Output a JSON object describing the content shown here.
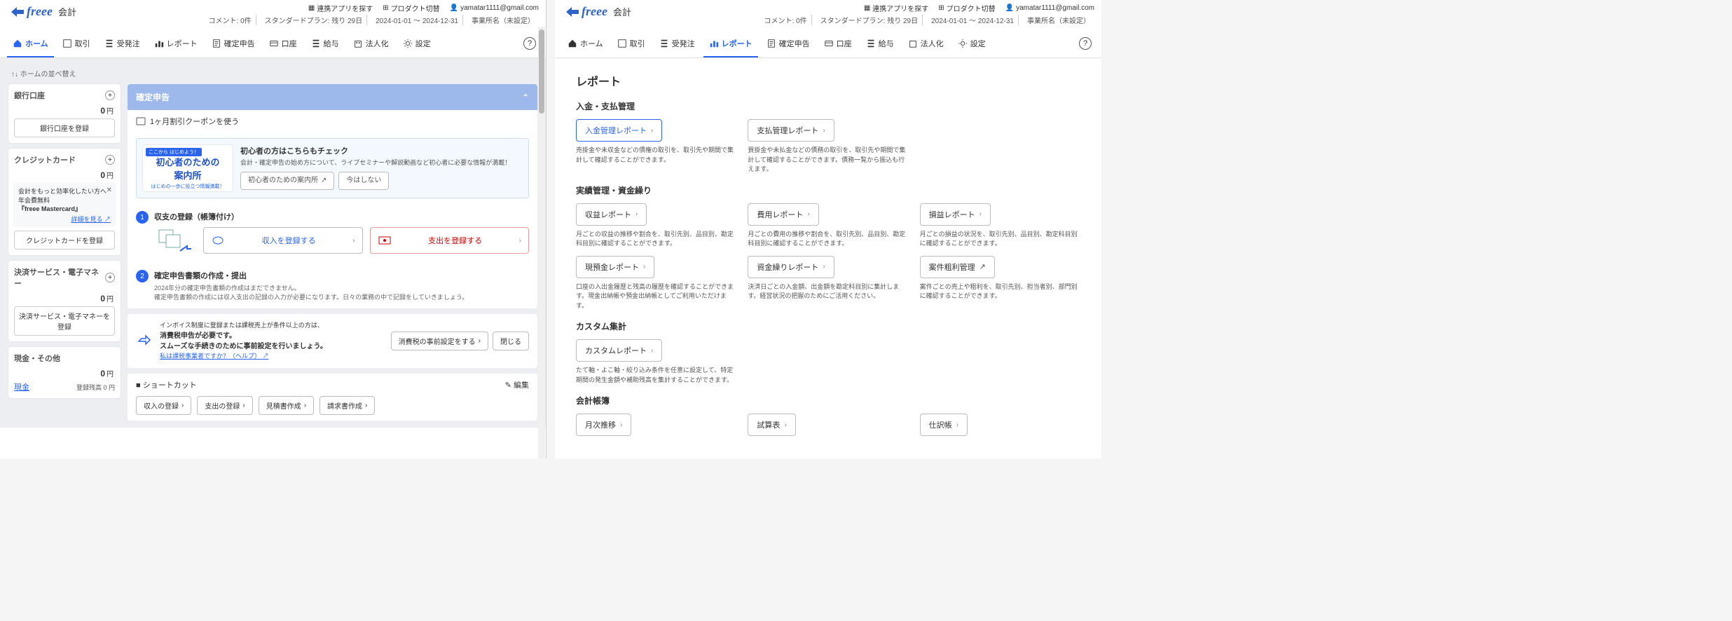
{
  "brand": {
    "name": "freee",
    "suffix": "会計"
  },
  "topbar": {
    "apps": "連携アプリを探す",
    "switch": "プロダクト切替",
    "user": "yamatar1111@gmail.com"
  },
  "statusbar": {
    "comment": "コメント: 0件",
    "plan": "スタンダードプラン: 残り 29日",
    "period": "2024-01-01 ～ 2024-12-31",
    "office": "事業所名（未設定）"
  },
  "nav": {
    "items": [
      {
        "label": "ホーム",
        "icon": "home"
      },
      {
        "label": "取引",
        "icon": "doc"
      },
      {
        "label": "受発注",
        "icon": "list"
      },
      {
        "label": "レポート",
        "icon": "chart"
      },
      {
        "label": "確定申告",
        "icon": "form"
      },
      {
        "label": "口座",
        "icon": "card"
      },
      {
        "label": "給与",
        "icon": "pay"
      },
      {
        "label": "法人化",
        "icon": "bldg"
      },
      {
        "label": "設定",
        "icon": "gear"
      }
    ]
  },
  "left_pane": {
    "crumb": "↑↓ ホームの並べ替え",
    "sidebar": {
      "bank": {
        "title": "銀行口座",
        "amount": "0",
        "unit": "円",
        "btn": "銀行口座を登録"
      },
      "cc": {
        "title": "クレジットカード",
        "amount": "0",
        "unit": "円",
        "promo": {
          "l1": "会計をもっと効率化したい方へ",
          "l2": "年会費無料",
          "l3": "『freee Mastercard』",
          "link": "詳細を見る"
        },
        "btn": "クレジットカードを登録"
      },
      "ps": {
        "title": "決済サービス・電子マネー",
        "amount": "0",
        "unit": "円",
        "btn": "決済サービス・電子マネーを登録"
      },
      "cash": {
        "title": "現金・その他",
        "amount": "0",
        "unit": "円",
        "link": "現金",
        "sub": "登録残高 0 円"
      }
    },
    "main": {
      "kakutei_title": "確定申告",
      "coupon": "1ヶ月割引クーポンを使う",
      "guide": {
        "img_ribbon": "ここから\nはじめよう！",
        "img_big": "初心者のための",
        "img_big2": "案内所",
        "img_foot": "はじめの一歩に役立つ情報満載！",
        "title": "初心者の方はこちらもチェック",
        "desc": "会計・確定申告の始め方について、ライブセミナーや解説動画など初心者に必要な情報が満載！",
        "btn1": "初心者のための案内所",
        "btn2": "今はしない"
      },
      "step1": {
        "num": "1",
        "title": "収支の登録（帳簿付け）",
        "btn_in": "収入を登録する",
        "btn_out": "支出を登録する"
      },
      "step2": {
        "num": "2",
        "title": "確定申告書類の作成・提出",
        "l1": "2024年分の確定申告書類の作成はまだできません。",
        "l2": "確定申告書類の作成には収入支出の記録の入力が必要になります。日々の業務の中で記録をしていきましょう。"
      },
      "invoice": {
        "l1": "インボイス制度に登録または課税売上が条件以上の方は、",
        "l2": "消費税申告が必要です。",
        "l3": "スムーズな手続きのために事前設定を行いましょう。",
        "link": "私は課税事業者ですか？（ヘルプ）",
        "btn1": "消費税の事前設定をする",
        "btn2": "閉じる"
      },
      "shortcut": {
        "title": "ショートカット",
        "edit": "編集",
        "b1": "収入の登録",
        "b2": "支出の登録",
        "b3": "見積書作成",
        "b4": "請求書作成"
      }
    }
  },
  "right_pane": {
    "title": "レポート",
    "s1": {
      "h": "入金・支払管理",
      "c1": {
        "btn": "入金管理レポート",
        "desc": "売掛金や未収金などの債権の取引を、取引先や期間で集計して確認することができます。"
      },
      "c2": {
        "btn": "支払管理レポート",
        "desc": "買掛金や未払金などの債務の取引を、取引先や期間で集計して確認することができます。債務一覧から振込も行えます。"
      }
    },
    "s2": {
      "h": "実績管理・資金繰り",
      "r1": {
        "c1": {
          "btn": "収益レポート",
          "desc": "月ごとの収益の推移や割合を、取引先別、品目別、勘定科目別に確認することができます。"
        },
        "c2": {
          "btn": "費用レポート",
          "desc": "月ごとの費用の推移や割合を、取引先別、品目別、勘定科目別に確認することができます。"
        },
        "c3": {
          "btn": "損益レポート",
          "desc": "月ごとの損益の状況を、取引先別、品目別、勘定科目別に確認することができます。"
        }
      },
      "r2": {
        "c1": {
          "btn": "現預金レポート",
          "desc": "口座の入出金履歴と残高の履歴を確認することができます。現金出納帳や預金出納帳としてご利用いただけます。"
        },
        "c2": {
          "btn": "資金繰りレポート",
          "desc": "決済日ごとの入金額、出金額を勘定科目別に集計します。経営状況の把握のためにご活用ください。"
        },
        "c3": {
          "btn": "案件粗利管理",
          "ext": true,
          "desc": "案件ごとの売上や粗利を、取引先別、担当者別、部門別に確認することができます。"
        }
      }
    },
    "s3": {
      "h": "カスタム集計",
      "c1": {
        "btn": "カスタムレポート",
        "desc": "たて軸・よこ軸・絞り込み条件を任意に設定して、特定期間の発生金額や補助残高を集計することができます。"
      }
    },
    "s4": {
      "h": "会計帳簿",
      "c1": {
        "btn": "月次推移"
      },
      "c2": {
        "btn": "試算表"
      },
      "c3": {
        "btn": "仕訳帳"
      }
    }
  }
}
